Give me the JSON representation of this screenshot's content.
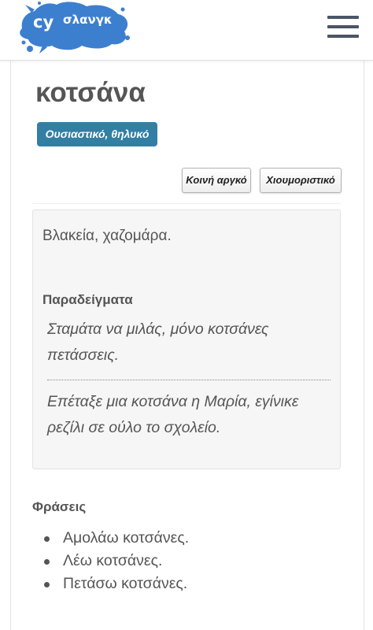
{
  "header": {
    "logo_cy": "cy",
    "logo_slang": "σλανγκ",
    "menu_icon": "hamburger-menu-icon"
  },
  "entry": {
    "word": "κοτσάνα",
    "part_of_speech": "Ουσιαστικό, θηλυκό",
    "tags": [
      "Κοινή αργκό",
      "Χιουμοριστικό"
    ],
    "definition": "Βλακεία, χαζομάρα.",
    "examples_heading": "Παραδείγματα",
    "examples": [
      "Σταμάτα να μιλάς, μόνο κοτσάνες πετάσσεις.",
      "Επέταξε μια κοτσάνα η Μαρία, εγίνικε ρεζίλι σε ούλο το σχολείο."
    ],
    "phrases_heading": "Φράσεις",
    "phrases": [
      "Αμολάω κοτσάνες.",
      "Λέω κοτσάνες.",
      "Πετάσω κοτσάνες."
    ]
  },
  "colors": {
    "badge": "#337fa3",
    "logo_splash": "#3d7fcf",
    "text": "#555555"
  }
}
